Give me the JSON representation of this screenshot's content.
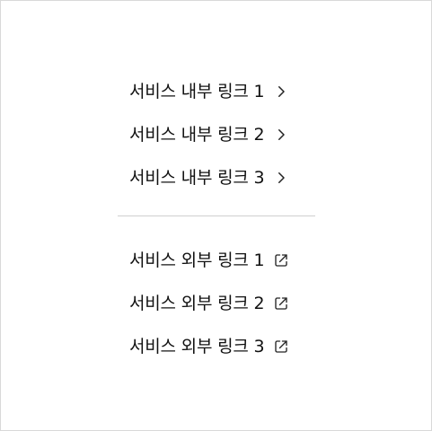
{
  "internal_links": [
    {
      "label": "서비스 내부 링크 1",
      "icon": "chevron-right-icon"
    },
    {
      "label": "서비스 내부 링크 2",
      "icon": "chevron-right-icon"
    },
    {
      "label": "서비스 내부 링크 3",
      "icon": "chevron-right-icon"
    }
  ],
  "external_links": [
    {
      "label": "서비스 외부 링크 1",
      "icon": "external-link-icon"
    },
    {
      "label": "서비스 외부 링크 2",
      "icon": "external-link-icon"
    },
    {
      "label": "서비스 외부 링크 3",
      "icon": "external-link-icon"
    }
  ],
  "colors": {
    "text": "#111111",
    "icon": "#222222",
    "divider": "#cfcfcf",
    "border": "#d9d9d9",
    "background": "#ffffff"
  }
}
